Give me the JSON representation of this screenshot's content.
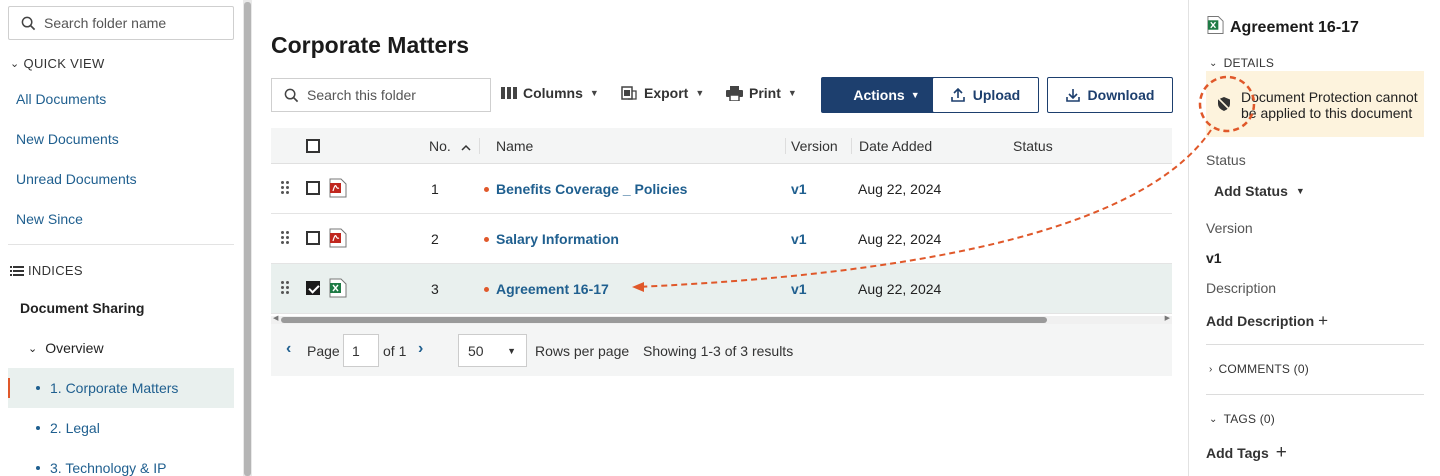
{
  "sidebar": {
    "search_placeholder": "Search folder name",
    "quick_view_label": "QUICK VIEW",
    "quick_view_items": [
      "All Documents",
      "New Documents",
      "Unread Documents",
      "New Since"
    ],
    "indices_label": "INDICES",
    "document_sharing": "Document Sharing",
    "overview": "Overview",
    "tree": [
      "1. Corporate Matters",
      "2. Legal",
      "3. Technology & IP"
    ],
    "active_index": 0
  },
  "main": {
    "title": "Corporate Matters",
    "search_placeholder": "Search this folder",
    "columns_label": "Columns",
    "export_label": "Export",
    "print_label": "Print",
    "actions_label": "Actions",
    "upload_label": "Upload",
    "download_label": "Download"
  },
  "table": {
    "headers": {
      "no": "No.",
      "name": "Name",
      "version": "Version",
      "date_added": "Date Added",
      "status": "Status"
    },
    "rows": [
      {
        "no": "1",
        "name": "Benefits Coverage _ Policies",
        "version": "v1",
        "date": "Aug 22, 2024",
        "type": "pdf",
        "checked": false
      },
      {
        "no": "2",
        "name": "Salary Information",
        "version": "v1",
        "date": "Aug 22, 2024",
        "type": "pdf",
        "checked": false
      },
      {
        "no": "3",
        "name": "Agreement 16-17",
        "version": "v1",
        "date": "Aug 22, 2024",
        "type": "excel",
        "checked": true
      }
    ]
  },
  "pager": {
    "page_label": "Page",
    "page_value": "1",
    "of_label": "of 1",
    "rows_value": "50",
    "rows_label": "Rows per page",
    "summary": "Showing 1-3 of 3 results"
  },
  "panel": {
    "title": "Agreement 16-17",
    "details_label": "DETAILS",
    "warning": "Document Protection cannot be applied to this document",
    "status_label": "Status",
    "add_status": "Add Status",
    "version_label": "Version",
    "version_value": "v1",
    "description_label": "Description",
    "add_description": "Add Description",
    "comments_label": "COMMENTS (0)",
    "tags_label": "TAGS (0)",
    "add_tags": "Add Tags"
  },
  "colors": {
    "accent": "#1d3f6e",
    "link": "#1f5f8f",
    "annotation": "#e0582a",
    "warning_bg": "#fdf3dd",
    "selected_row": "#e9f0ee"
  }
}
